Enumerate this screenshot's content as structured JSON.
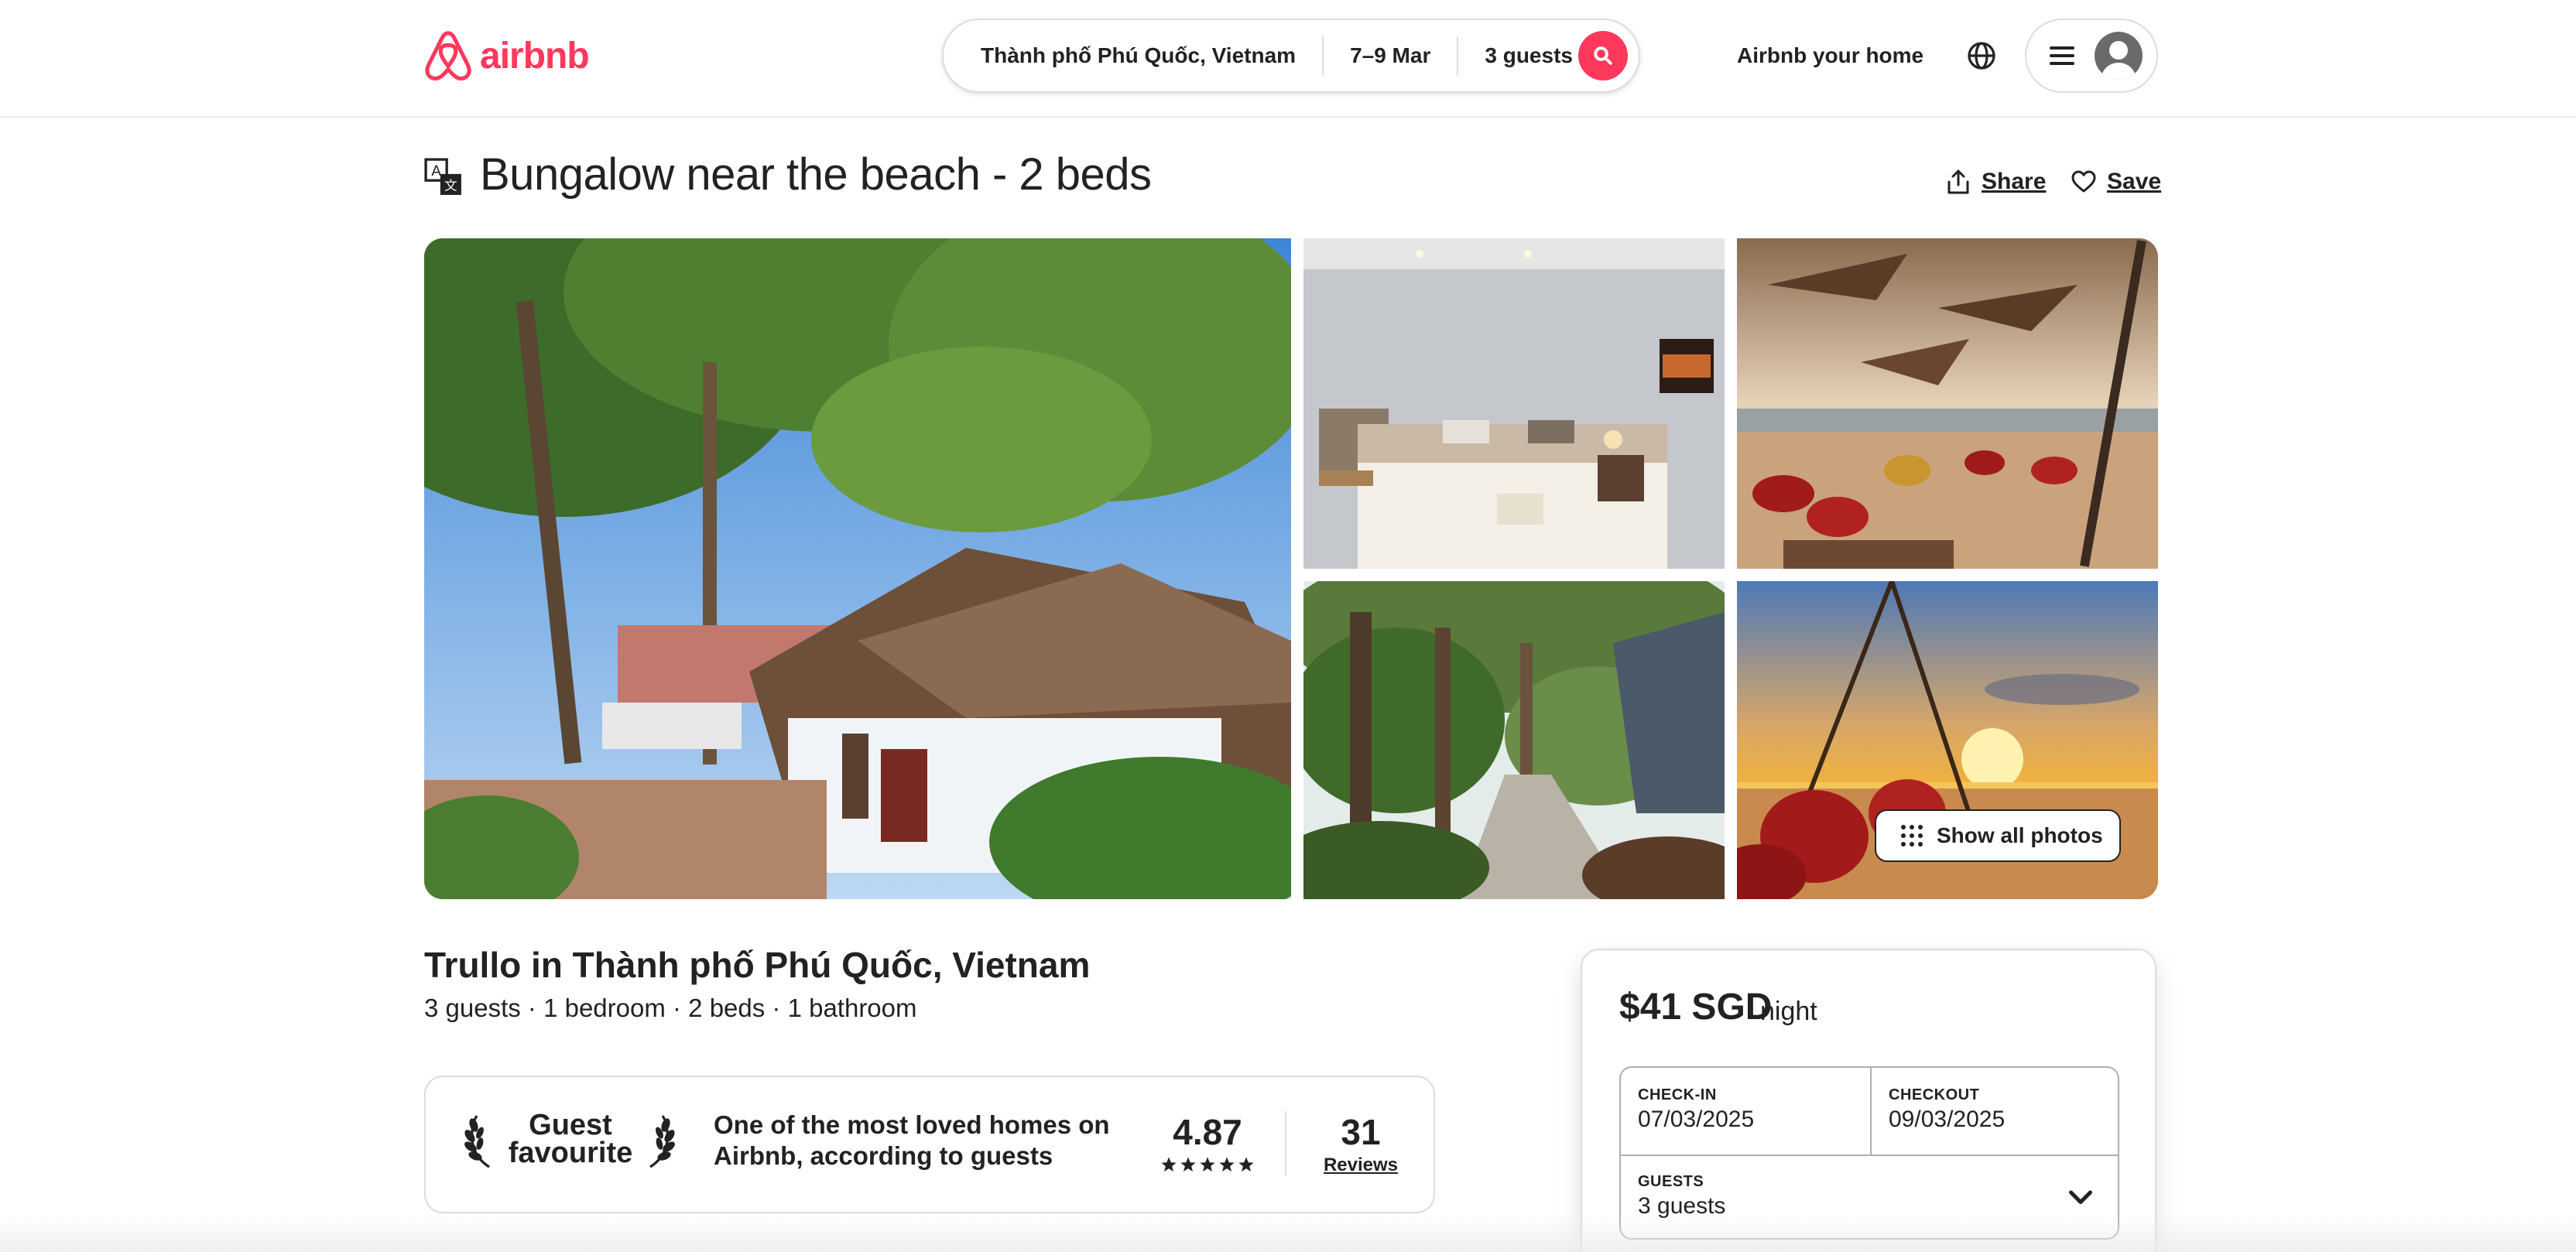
{
  "header": {
    "logo_text": "airbnb",
    "search": {
      "location": "Thành phố Phú Quốc, Vietnam",
      "dates": "7–9 Mar",
      "guests": "3 guests"
    },
    "host_link": "Airbnb your home"
  },
  "listing": {
    "title": "Bungalow near the beach - 2 beds",
    "share_label": "Share",
    "save_label": "Save",
    "show_all_photos": "Show all photos",
    "type_location": "Trullo in Thành phố Phú Quốc, Vietnam",
    "meta": "3 guests · 1 bedroom · 2 beds · 1 bathroom"
  },
  "guest_favourite": {
    "label_line1": "Guest",
    "label_line2": "favourite",
    "description": "One of the most loved homes on Airbnb, according to guests",
    "rating": "4.87",
    "stars": 5,
    "review_count": "31",
    "review_label": "Reviews"
  },
  "booking": {
    "price": "$41 SGD",
    "per": "night",
    "checkin_label": "CHECK-IN",
    "checkin_value": "07/03/2025",
    "checkout_label": "CHECKOUT",
    "checkout_value": "09/03/2025",
    "guests_label": "GUESTS",
    "guests_value": "3 guests"
  },
  "colors": {
    "brand": "#ff385c",
    "text": "#222222",
    "border": "#dddddd"
  },
  "icons": [
    "airbnb-logo-icon",
    "search-icon",
    "globe-icon",
    "menu-icon",
    "avatar-icon",
    "translate-icon",
    "share-icon",
    "heart-icon",
    "grid-dots-icon",
    "laurel-icon",
    "star-icon",
    "chevron-down-icon"
  ]
}
